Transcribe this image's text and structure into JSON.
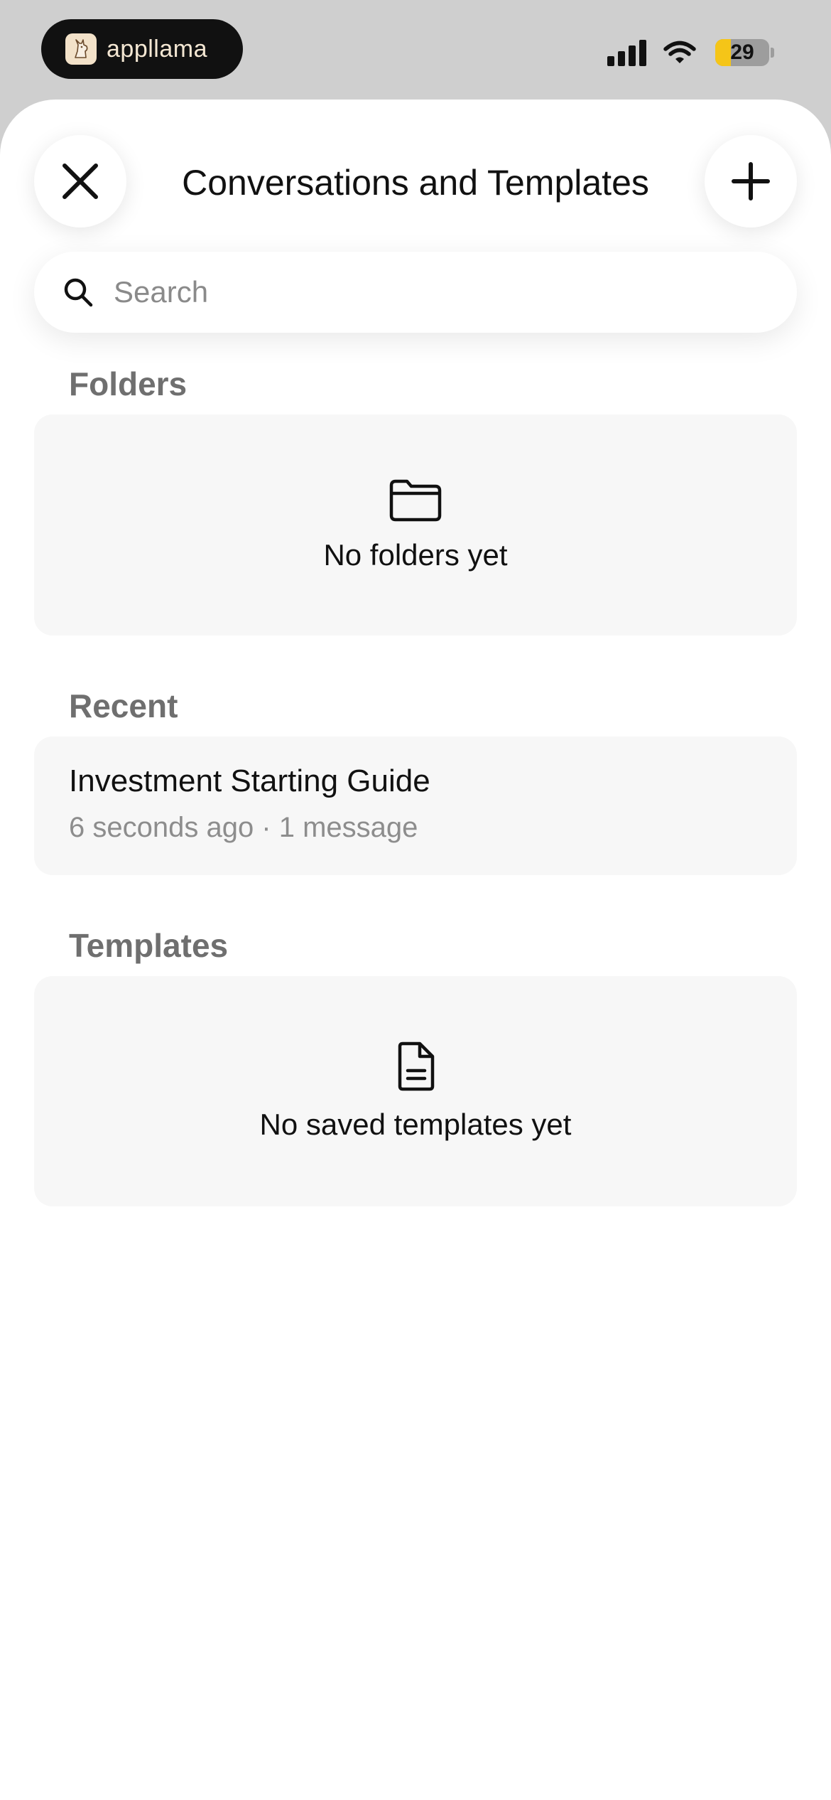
{
  "status_bar": {
    "app_name": "appllama",
    "battery_level": "29",
    "battery_fraction": 0.29
  },
  "header": {
    "title": "Conversations and Templates"
  },
  "search": {
    "placeholder": "Search",
    "value": ""
  },
  "folders": {
    "heading": "Folders",
    "empty_text": "No folders yet"
  },
  "recent": {
    "heading": "Recent",
    "items": [
      {
        "title": "Investment Starting Guide",
        "meta": "6 seconds ago · 1 message"
      }
    ]
  },
  "templates": {
    "heading": "Templates",
    "empty_text": "No saved templates yet"
  },
  "colors": {
    "sheet_background": "#ffffff",
    "status_background": "#cfcfcf",
    "card_background": "#f7f7f7",
    "battery_accent": "#f5c518",
    "section_heading": "#6f6f6f"
  }
}
